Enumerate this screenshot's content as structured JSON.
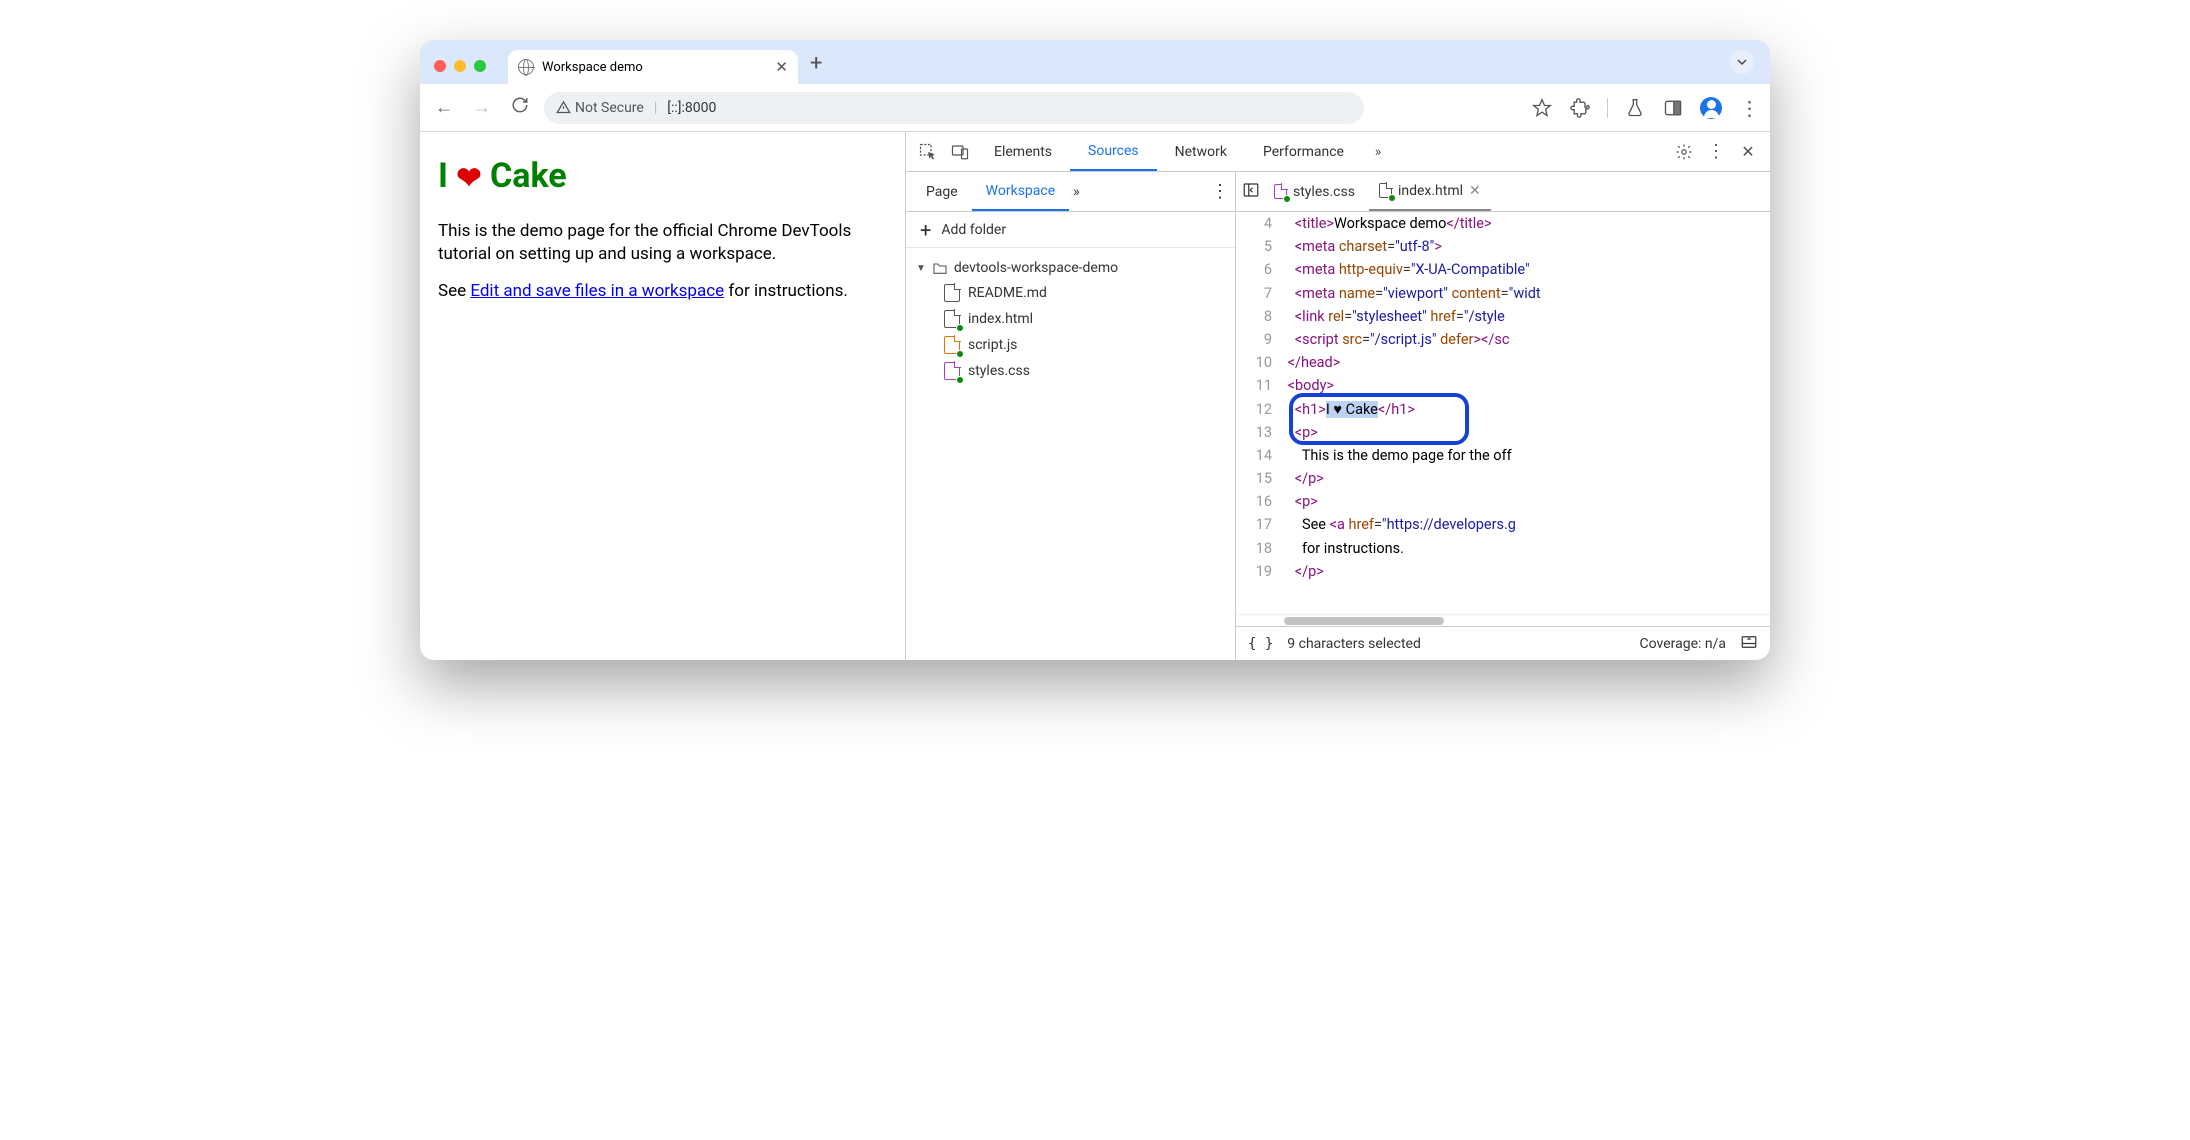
{
  "browser": {
    "tab_title": "Workspace demo",
    "security_label": "Not Secure",
    "url": "[::]:8000"
  },
  "page": {
    "h1_prefix": "I ",
    "h1_heart": "❤",
    "h1_suffix": " Cake",
    "para1": "This is the demo page for the official Chrome DevTools tutorial on setting up and using a workspace.",
    "para2_prefix": "See ",
    "para2_link": "Edit and save files in a workspace",
    "para2_suffix": " for instructions."
  },
  "devtools": {
    "panels": {
      "elements": "Elements",
      "sources": "Sources",
      "network": "Network",
      "performance": "Performance"
    },
    "sources": {
      "tabs": {
        "page": "Page",
        "workspace": "Workspace"
      },
      "add_folder": "Add folder",
      "folder_name": "devtools-workspace-demo",
      "files": {
        "readme": "README.md",
        "index": "index.html",
        "script": "script.js",
        "styles": "styles.css"
      }
    },
    "editor": {
      "open_tabs": {
        "styles": "styles.css",
        "index": "index.html"
      },
      "lines": [
        {
          "n": 4,
          "html": "   <span class='t-tag'>&lt;title&gt;</span><span class='t-txt'>Workspace demo</span><span class='t-tag'>&lt;/title&gt;</span>"
        },
        {
          "n": 5,
          "html": "   <span class='t-tag'>&lt;meta</span> <span class='t-attr'>charset</span>=<span class='t-str'>\"utf-8\"</span><span class='t-tag'>&gt;</span>"
        },
        {
          "n": 6,
          "html": "   <span class='t-tag'>&lt;meta</span> <span class='t-attr'>http-equiv</span>=<span class='t-str'>\"X-UA-Compatible\"</span>"
        },
        {
          "n": 7,
          "html": "   <span class='t-tag'>&lt;meta</span> <span class='t-attr'>name</span>=<span class='t-str'>\"viewport\"</span> <span class='t-attr'>content</span>=<span class='t-str'>\"widt</span>"
        },
        {
          "n": 8,
          "html": "   <span class='t-tag'>&lt;link</span> <span class='t-attr'>rel</span>=<span class='t-str'>\"stylesheet\"</span> <span class='t-attr'>href</span>=<span class='t-str'>\"/style</span>"
        },
        {
          "n": 9,
          "html": "   <span class='t-tag'>&lt;script</span> <span class='t-attr'>src</span>=<span class='t-str'>\"/script.js\"</span> <span class='t-attr'>defer</span><span class='t-tag'>&gt;&lt;/sc</span>"
        },
        {
          "n": 10,
          "html": " <span class='t-tag'>&lt;/head&gt;</span>"
        },
        {
          "n": 11,
          "html": " <span class='t-tag'>&lt;body&gt;</span>"
        },
        {
          "n": 12,
          "html": "   <span class='t-tag'>&lt;h1&gt;</span><span class='t-txt' style='background:#bcd3f5'>I ♥ Cake</span><span class='t-tag'>&lt;/h1&gt;</span>"
        },
        {
          "n": 13,
          "html": "   <span class='t-tag'>&lt;p&gt;</span>"
        },
        {
          "n": 14,
          "html": "     <span class='t-txt'>This is the demo page for the off</span>"
        },
        {
          "n": 15,
          "html": "   <span class='t-tag'>&lt;/p&gt;</span>"
        },
        {
          "n": 16,
          "html": "   <span class='t-tag'>&lt;p&gt;</span>"
        },
        {
          "n": 17,
          "html": "     <span class='t-txt'>See </span><span class='t-tag'>&lt;a</span> <span class='t-attr'>href</span>=<span class='t-str'>\"https://developers.g</span>"
        },
        {
          "n": 18,
          "html": "     <span class='t-txt'>for instructions.</span>"
        },
        {
          "n": 19,
          "html": "   <span class='t-tag'>&lt;/p&gt;</span>"
        }
      ]
    },
    "statusbar": {
      "selection": "9 characters selected",
      "coverage": "Coverage: n/a"
    }
  }
}
